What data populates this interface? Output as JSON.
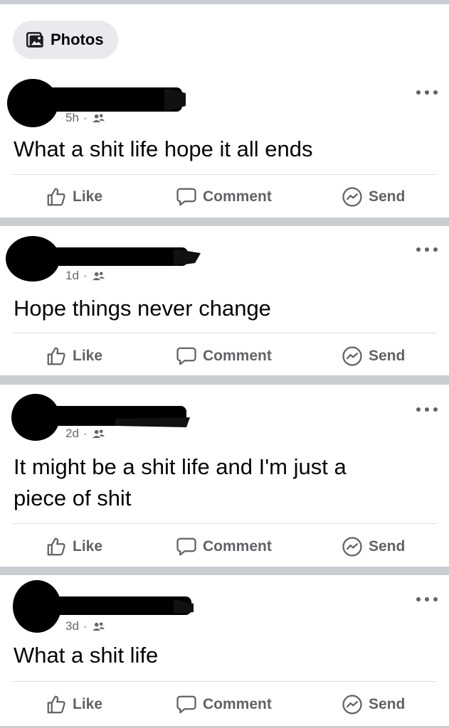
{
  "photos_chip": {
    "label": "Photos",
    "icon": "photos-icon"
  },
  "posts": [
    {
      "time": "5h",
      "text_lines": [
        "What a shit life hope it all ends"
      ]
    },
    {
      "time": "1d",
      "text_lines": [
        "Hope things never change"
      ]
    },
    {
      "time": "2d",
      "text_lines": [
        "It might be a shit life and I'm just a",
        "piece of shit"
      ]
    },
    {
      "time": "3d",
      "text_lines": [
        "What a shit life"
      ]
    }
  ],
  "actions": {
    "like": "Like",
    "comment": "Comment",
    "send": "Send"
  },
  "colors": {
    "background": "#c9ccd1",
    "card": "#ffffff",
    "text": "#050505",
    "secondary": "#65676b",
    "icon": "#606266"
  }
}
